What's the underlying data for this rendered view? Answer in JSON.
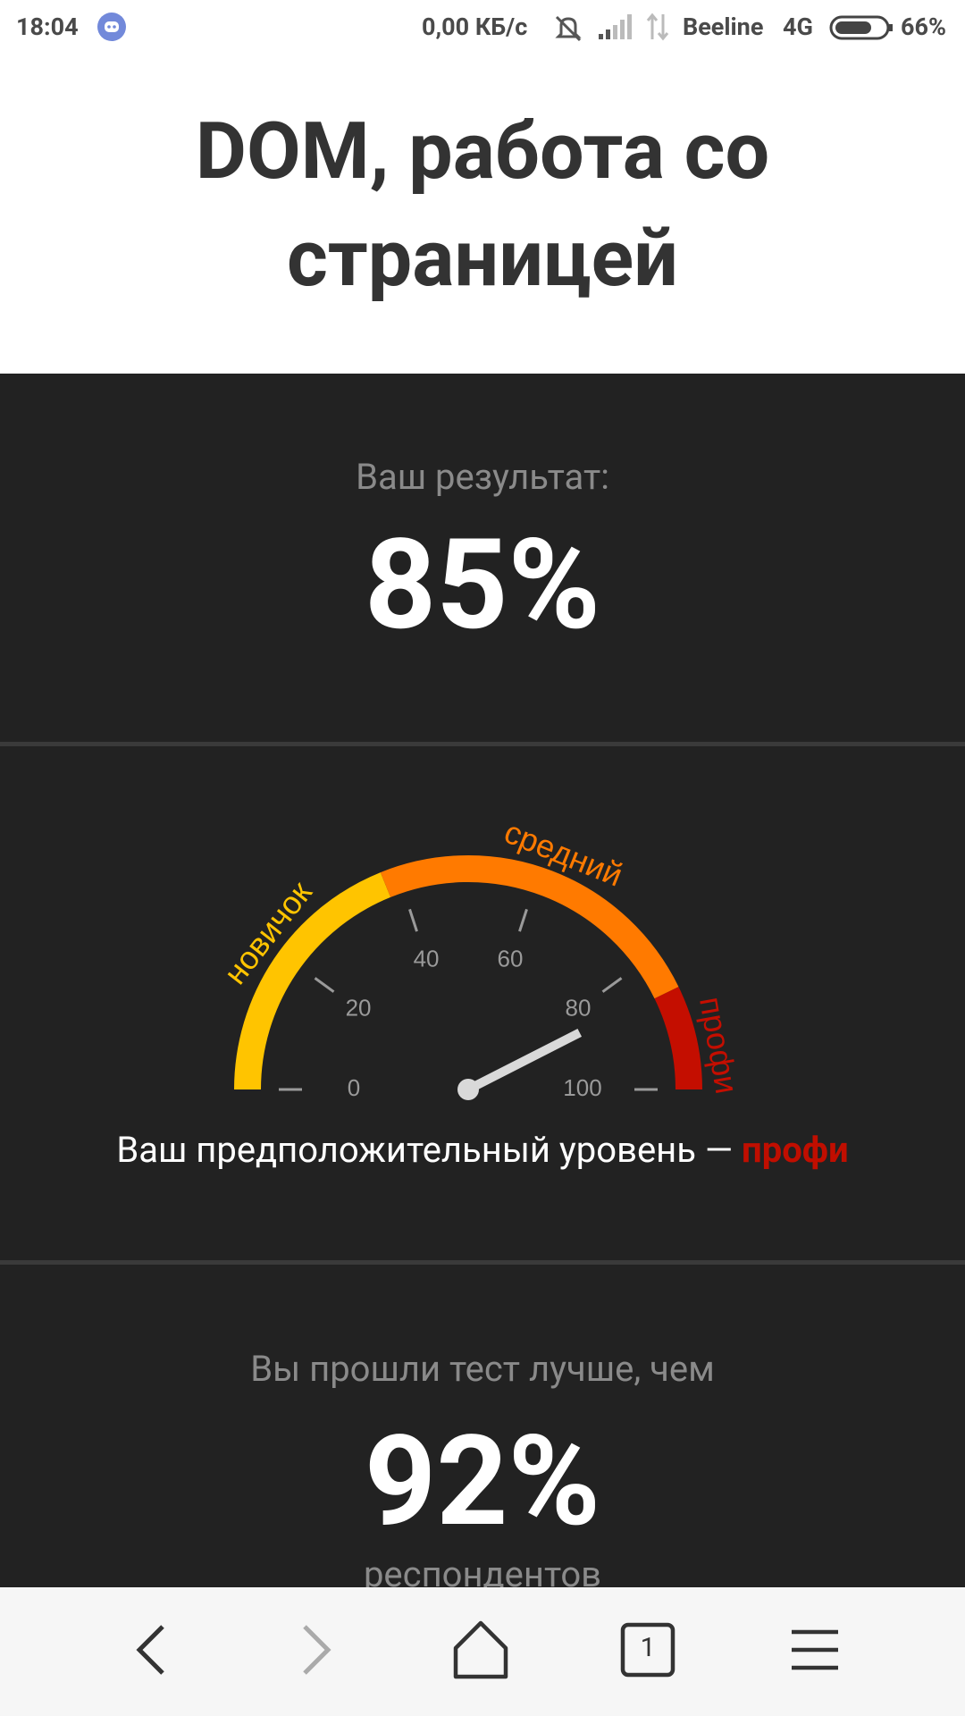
{
  "status_bar": {
    "time": "18:04",
    "speed": "0,00 КБ/с",
    "carrier": "Beeline",
    "network": "4G",
    "battery": "66%"
  },
  "title": "DOM, работа со страницей",
  "result": {
    "label": "Ваш результат:",
    "value": "85%"
  },
  "gauge": {
    "ticks": [
      "0",
      "20",
      "40",
      "60",
      "80",
      "100"
    ],
    "zones": [
      {
        "name": "новичок",
        "color": "#ffc400"
      },
      {
        "name": "средний",
        "color": "#ff7a00"
      },
      {
        "name": "профи",
        "color": "#c40e00"
      }
    ],
    "needle_value": 85
  },
  "level": {
    "prefix": "Ваш предположительный уровень — ",
    "value": "профи"
  },
  "comparison": {
    "label": "Вы прошли тест лучше, чем",
    "value": "92%",
    "suffix": "респондентов"
  },
  "nav": {
    "tab_count": "1"
  },
  "icons": [
    "discord-icon",
    "mute-icon",
    "signal-icon",
    "data-arrows-icon",
    "battery-icon",
    "back-icon",
    "forward-icon",
    "home-icon",
    "tabs-icon",
    "menu-icon"
  ],
  "colors": {
    "dark_bg": "#222222",
    "accent_profi": "#c00e00"
  }
}
